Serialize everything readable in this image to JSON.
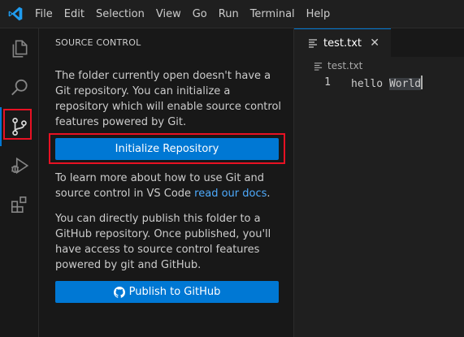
{
  "menu": [
    "File",
    "Edit",
    "Selection",
    "View",
    "Go",
    "Run",
    "Terminal",
    "Help"
  ],
  "activity_icons": [
    "explorer-icon",
    "search-icon",
    "source-control-icon",
    "run-debug-icon",
    "extensions-icon"
  ],
  "sidebar": {
    "title": "SOURCE CONTROL",
    "intro": "The folder currently open doesn't have a Git repository. You can initialize a repository which will enable source control features powered by Git.",
    "init_button": "Initialize Repository",
    "learn_prefix": "To learn more about how to use Git and source control in VS Code ",
    "learn_link": "read our docs",
    "learn_suffix": ".",
    "publish_text": "You can directly publish this folder to a GitHub repository. Once published, you'll have access to source control features powered by git and GitHub.",
    "publish_button": "Publish to GitHub"
  },
  "editor": {
    "tab_label": "test.txt",
    "breadcrumb": "test.txt",
    "line_number": "1",
    "code_before": "hello ",
    "code_highlight": "World"
  },
  "colors": {
    "accent": "#0078d4",
    "highlight_box": "#e81123",
    "link": "#4daafc"
  }
}
